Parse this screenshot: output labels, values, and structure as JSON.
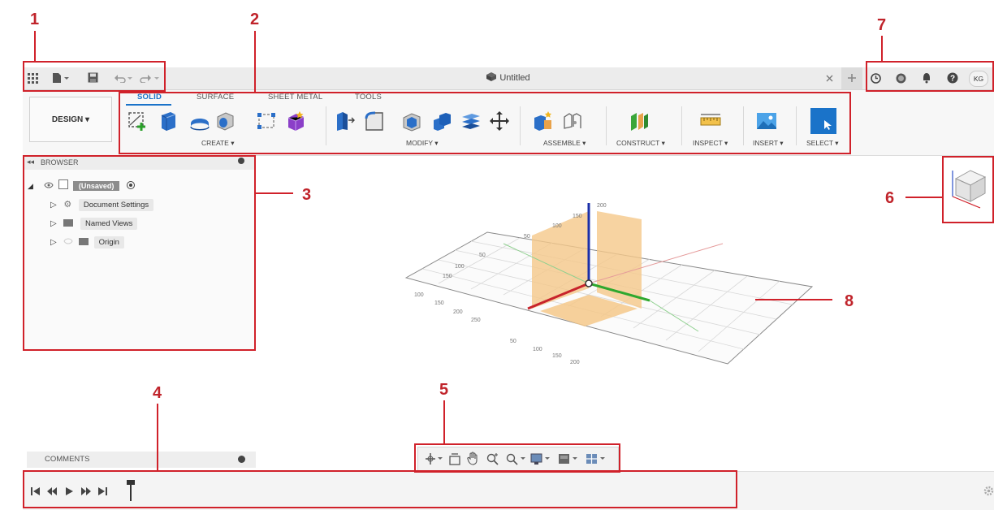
{
  "callouts": [
    "1",
    "2",
    "3",
    "4",
    "5",
    "6",
    "7",
    "8"
  ],
  "window": {
    "title": "Untitled",
    "user_initials": "KG"
  },
  "ribbon": {
    "workspace_button": "DESIGN ▾",
    "tabs": [
      "SOLID",
      "SURFACE",
      "SHEET METAL",
      "TOOLS"
    ],
    "groups": [
      "CREATE ▾",
      "MODIFY ▾",
      "ASSEMBLE ▾",
      "CONSTRUCT ▾",
      "INSPECT ▾",
      "INSERT ▾",
      "SELECT ▾"
    ]
  },
  "browser": {
    "header": "BROWSER",
    "root_label": "(Unsaved)",
    "items": [
      "Document Settings",
      "Named Views",
      "Origin"
    ]
  },
  "comments": {
    "label": "COMMENTS"
  },
  "grid_labels": [
    "100",
    "150",
    "200",
    "250",
    "100",
    "150",
    "50",
    "50",
    "100",
    "150",
    "200",
    "50",
    "100",
    "150",
    "200"
  ],
  "colors": {
    "callout_red": "#d0212a",
    "accent_blue": "#1a73c9",
    "plane_orange": "#f5c88a",
    "axis_red": "#c8242c",
    "axis_green": "#2fa82f",
    "axis_blue": "#1b2fa8"
  },
  "icons": {
    "app_menu": "grid-icon",
    "file": "file-icon",
    "save": "save-icon",
    "undo": "undo-icon",
    "redo": "redo-icon",
    "close": "close-icon",
    "new_tab": "plus-icon",
    "job_status": "clock-icon",
    "notifications": "bell-icon",
    "help": "help-icon"
  }
}
